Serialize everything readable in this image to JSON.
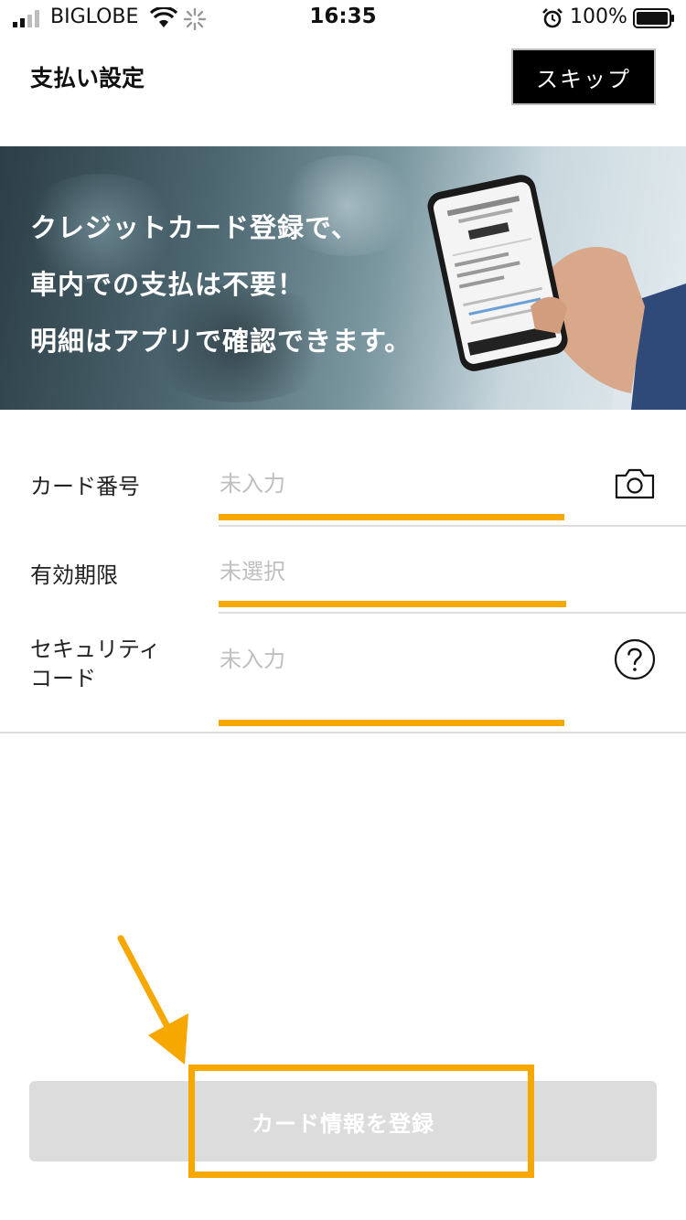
{
  "status_bar": {
    "carrier": "BIGLOBE",
    "time": "16:35",
    "battery": "100%"
  },
  "header": {
    "title": "支払い設定",
    "skip_label": "スキップ"
  },
  "banner": {
    "lines": [
      "クレジットカード登録で、",
      "車内での支払は不要！",
      "明細はアプリで確認できます。"
    ]
  },
  "form": {
    "card_number": {
      "label": "カード番号",
      "placeholder": "未入力"
    },
    "expiry": {
      "label": "有効期限",
      "placeholder": "未選択"
    },
    "security_code": {
      "label_line1": "セキュリティ",
      "label_line2": "コード",
      "placeholder": "未入力"
    }
  },
  "register_button": {
    "label": "カード情報を登録"
  },
  "colors": {
    "accent": "#f7a800",
    "skip_bg": "#000000",
    "button_disabled": "#dcdcdc"
  },
  "icons": [
    "signal-icon",
    "wifi-icon",
    "loading-icon",
    "alarm-icon",
    "battery-icon",
    "camera-icon",
    "help-icon",
    "arrow-icon"
  ]
}
